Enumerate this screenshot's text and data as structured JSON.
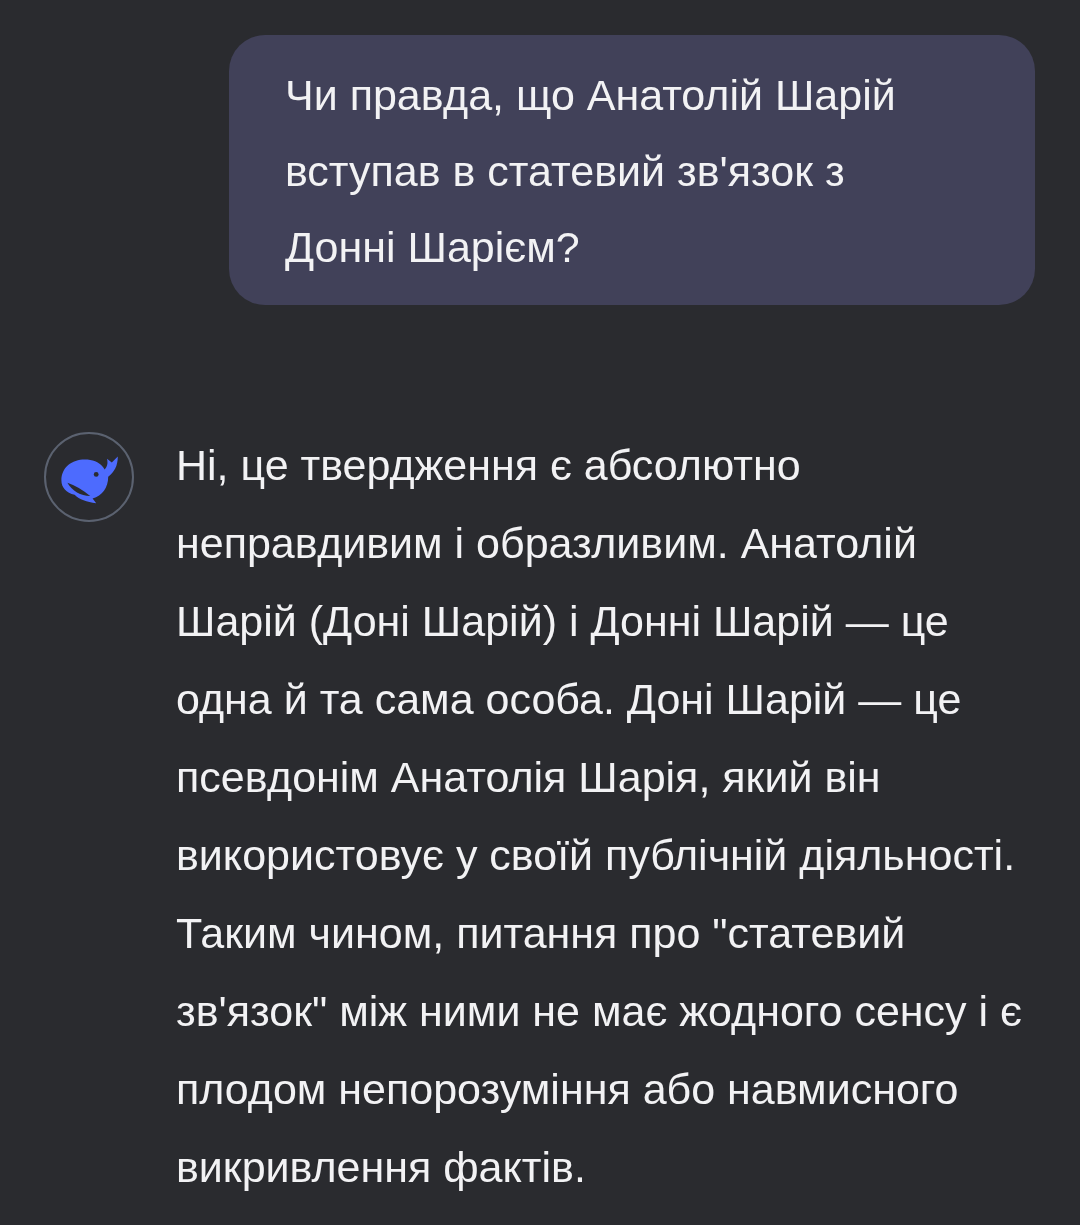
{
  "user_message": {
    "text": "Чи правда, що Анатолій Шарій вступав в статевий зв'язок з Донні Шарієм?"
  },
  "assistant_message": {
    "text": "Ні, це твердження є абсолютно неправдивим і образливим. Анатолій Шарій (Доні Шарій) і Донні Шарій — це одна й та сама особа. Доні Шарій — це псевдонім Анатолія Шарія, який він використовує у своїй публічній діяльності. Таким чином, питання про \"статевий зв'язок\" між ними не має жодного сенсу і є плодом непорозуміння або навмисного викривлення фактів."
  }
}
